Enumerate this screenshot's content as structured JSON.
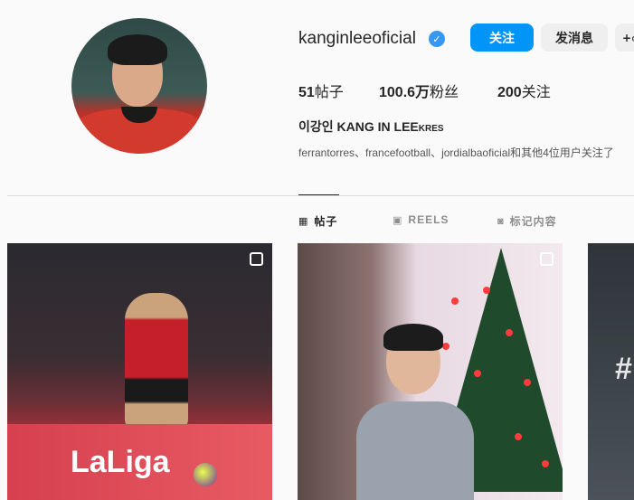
{
  "profile": {
    "username": "kanginleeoficial",
    "verified_icon": "verified-badge-icon",
    "follow_label": "关注",
    "message_label": "发消息",
    "suggest_label": "+\u0001",
    "stats": {
      "posts_count": "51",
      "posts_label": "帖子",
      "followers_count": "100.6万",
      "followers_label": "粉丝",
      "following_count": "200",
      "following_label": "关注"
    },
    "full_name": "이강인 KANG IN LEE",
    "full_name_suffix": "KRES",
    "mutuals": "ferrantorres、francefootball、jordialbaoficial和其他4位用户关注了"
  },
  "tabs": [
    {
      "label": "帖子",
      "icon": "grid-icon",
      "active": true
    },
    {
      "label": "REELS",
      "icon": "reels-icon",
      "active": false
    },
    {
      "label": "标记内容",
      "icon": "tagged-icon",
      "active": false
    }
  ],
  "posts": [
    {
      "banner_text": "LaLiga",
      "icon": "multi-post-icon"
    },
    {
      "icon": "multi-post-icon"
    },
    {
      "text": "#"
    }
  ],
  "colors": {
    "accent": "#0095f6",
    "verified": "#3897f0"
  }
}
